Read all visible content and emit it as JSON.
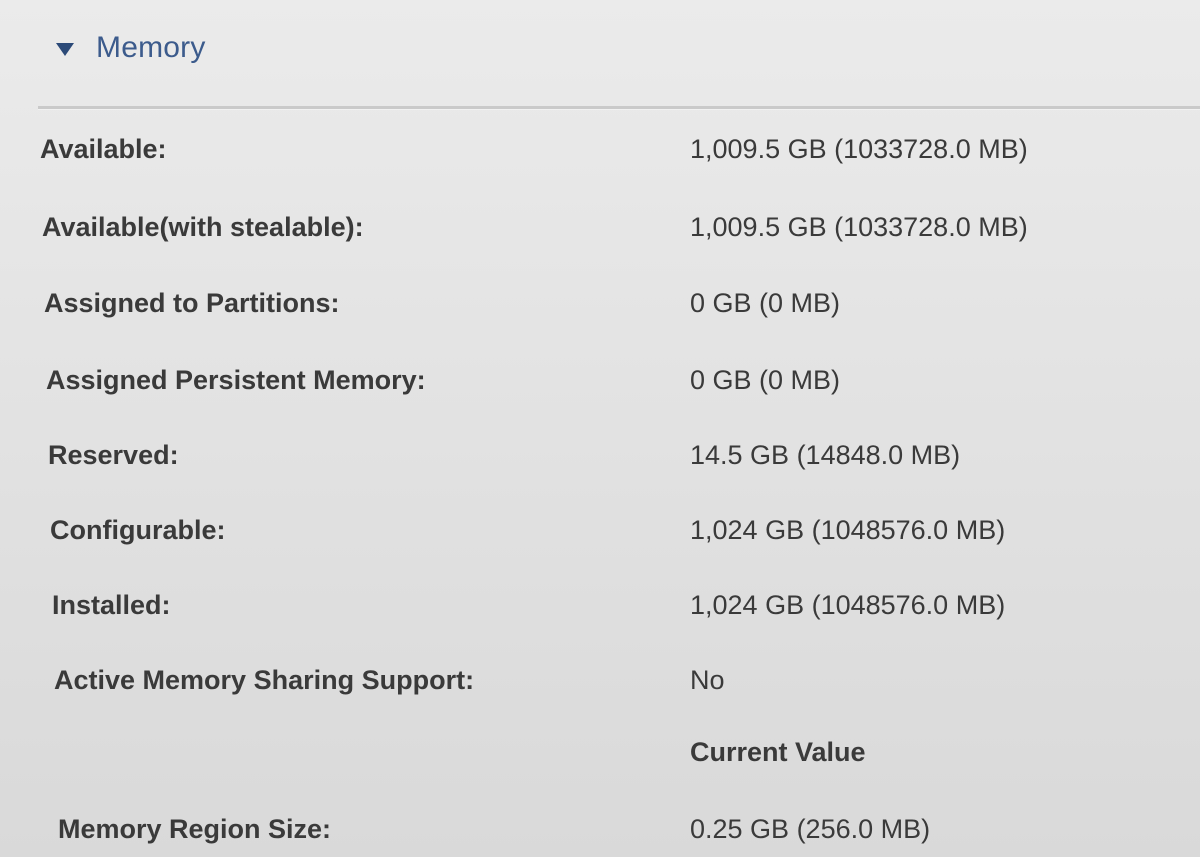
{
  "section": {
    "title": "Memory",
    "toggle_icon": "triangle-down-icon"
  },
  "rows": [
    {
      "label": "Available:",
      "value": "1,009.5 GB (1033728.0 MB)"
    },
    {
      "label": "Available(with stealable):",
      "value": "1,009.5 GB (1033728.0 MB)"
    },
    {
      "label": "Assigned to Partitions:",
      "value": "0 GB (0 MB)"
    },
    {
      "label": "Assigned Persistent Memory:",
      "value": "0 GB (0 MB)"
    },
    {
      "label": "Reserved:",
      "value": "14.5 GB (14848.0 MB)"
    },
    {
      "label": "Configurable:",
      "value": "1,024 GB (1048576.0 MB)"
    },
    {
      "label": "Installed:",
      "value": "1,024 GB (1048576.0 MB)"
    },
    {
      "label": "Active Memory Sharing Support:",
      "value": "No"
    }
  ],
  "current_value_header": "Current Value",
  "region_row": {
    "label": "Memory Region Size:",
    "value": "0.25 GB (256.0 MB)"
  },
  "colors": {
    "section_title": "#3c5b8c",
    "text": "#3a3a3a",
    "background": "#e4e4e4"
  }
}
